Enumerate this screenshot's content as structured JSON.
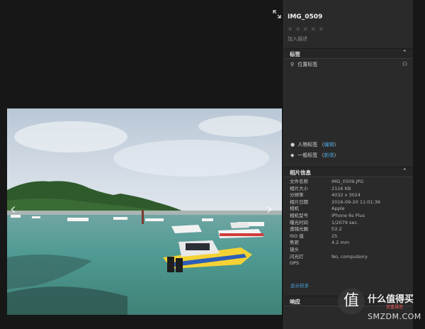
{
  "viewer": {
    "prev_label": "‹",
    "next_label": "›",
    "expand_icon": "expand-icon"
  },
  "panel": {
    "title": "IMG_0509",
    "stars": "★★★★★",
    "add_description": "加入描述",
    "tags_section": "标签",
    "location_tag": "位置标签",
    "people_tag": "人物标签",
    "people_action": "编辑",
    "general_tag": "一般标签",
    "general_action": "新增",
    "info_section": "相片信息",
    "info_rows": [
      {
        "key": "文件名称",
        "value": "IMG_0509.JPG"
      },
      {
        "key": "相片大小",
        "value": "2116 KB"
      },
      {
        "key": "分辨率",
        "value": "4032 x 3024"
      },
      {
        "key": "相片日期",
        "value": "2016-09-20 11:01:36"
      },
      {
        "key": "相机",
        "value": "Apple"
      },
      {
        "key": "相机型号",
        "value": "iPhone 6s Plus"
      },
      {
        "key": "曝光时间",
        "value": "1/2079 sec."
      },
      {
        "key": "透镜光圈",
        "value": "f/2.2"
      },
      {
        "key": "ISO 值",
        "value": "25"
      },
      {
        "key": "焦距",
        "value": "4.2 mm"
      },
      {
        "key": "镜头",
        "value": ""
      },
      {
        "key": "闪光灯",
        "value": "No, compulsory"
      },
      {
        "key": "GPS",
        "value": ""
      }
    ],
    "show_more": "显示较多",
    "response_section": "响应"
  },
  "watermark": {
    "glyph": "值",
    "text": "什么值得买",
    "sub": "双重福音",
    "brand": "SMZDM.COM"
  },
  "colors": {
    "panel_bg": "#2a2a2a",
    "link": "#4aa6e0",
    "viewer_bg": "#171717"
  }
}
